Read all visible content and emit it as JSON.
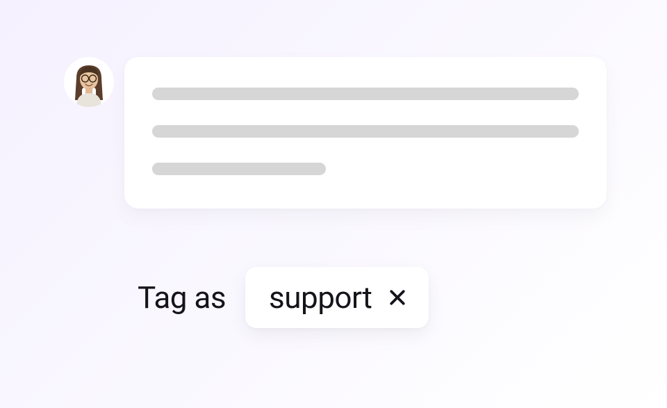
{
  "message": {
    "avatar_alt": "user-avatar"
  },
  "tag": {
    "label": "Tag as",
    "value": "support"
  }
}
